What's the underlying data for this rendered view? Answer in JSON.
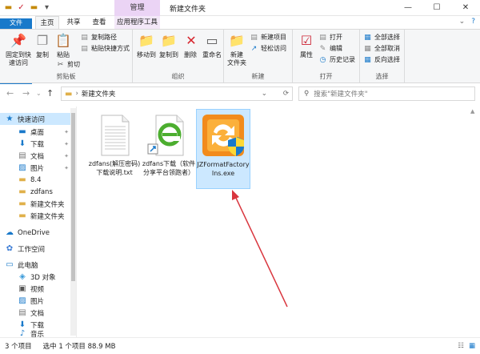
{
  "window": {
    "title": "新建文件夹",
    "context_tab": "管理",
    "controls": [
      "—",
      "☐",
      "✕"
    ]
  },
  "tabs": [
    {
      "label": "文件"
    },
    {
      "label": "主页"
    },
    {
      "label": "共享"
    },
    {
      "label": "查看"
    },
    {
      "label": "应用程序工具"
    }
  ],
  "ribbon": {
    "clipboard": {
      "label": "剪贴板",
      "pin": "固定到快\n速访问",
      "copy": "复制",
      "paste": "粘贴",
      "copy_path": "复制路径",
      "paste_shortcut": "粘贴快捷方式",
      "cut": "剪切"
    },
    "organize": {
      "label": "组织",
      "move_to": "移动到",
      "copy_to": "复制到",
      "delete": "删除",
      "rename": "重命名"
    },
    "new": {
      "label": "新建",
      "new_folder": "新建\n文件夹",
      "new_item": "新建项目",
      "easy_access": "轻松访问"
    },
    "open": {
      "label": "打开",
      "properties": "属性",
      "open": "打开",
      "edit": "编辑",
      "history": "历史记录"
    },
    "select": {
      "label": "选择",
      "select_all": "全部选择",
      "select_none": "全部取消",
      "invert": "反向选择"
    }
  },
  "address": {
    "path": "新建文件夹",
    "search_placeholder": "搜索\"新建文件夹\""
  },
  "sidebar": {
    "items": [
      {
        "label": "快速访问",
        "icon": "star-icon"
      },
      {
        "label": "桌面",
        "icon": "desktop-icon"
      },
      {
        "label": "下载",
        "icon": "download-icon"
      },
      {
        "label": "文档",
        "icon": "document-icon"
      },
      {
        "label": "图片",
        "icon": "picture-icon"
      },
      {
        "label": "8.4",
        "icon": "folder-icon"
      },
      {
        "label": "zdfans",
        "icon": "folder-icon"
      },
      {
        "label": "新建文件夹",
        "icon": "folder-icon"
      },
      {
        "label": "新建文件夹",
        "icon": "folder-icon"
      },
      {
        "label": "OneDrive",
        "icon": "cloud-icon"
      },
      {
        "label": "工作空间",
        "icon": "workspace-icon"
      },
      {
        "label": "此电脑",
        "icon": "computer-icon"
      },
      {
        "label": "3D 对象",
        "icon": "cube-icon"
      },
      {
        "label": "视频",
        "icon": "video-icon"
      },
      {
        "label": "图片",
        "icon": "picture-icon"
      },
      {
        "label": "文档",
        "icon": "document-icon"
      },
      {
        "label": "下载",
        "icon": "download-icon"
      },
      {
        "label": "音乐",
        "icon": "music-icon"
      }
    ]
  },
  "files": [
    {
      "name": "zdfans(解压密码)下载说明.txt",
      "icon": "text-file-icon"
    },
    {
      "name": "zdfans下载（软件分享平台领跑者）",
      "icon": "shortcut-ie-icon"
    },
    {
      "name": "JZFormatFactoryIns.exe",
      "icon": "format-factory-icon"
    }
  ],
  "status": {
    "count": "3 个项目",
    "selected": "选中 1 个项目 88.9 MB"
  },
  "colors": {
    "accent": "#1979ca",
    "context_tab": "#ebd4f5",
    "selection": "#cce8ff",
    "arrow": "#d9363e"
  }
}
